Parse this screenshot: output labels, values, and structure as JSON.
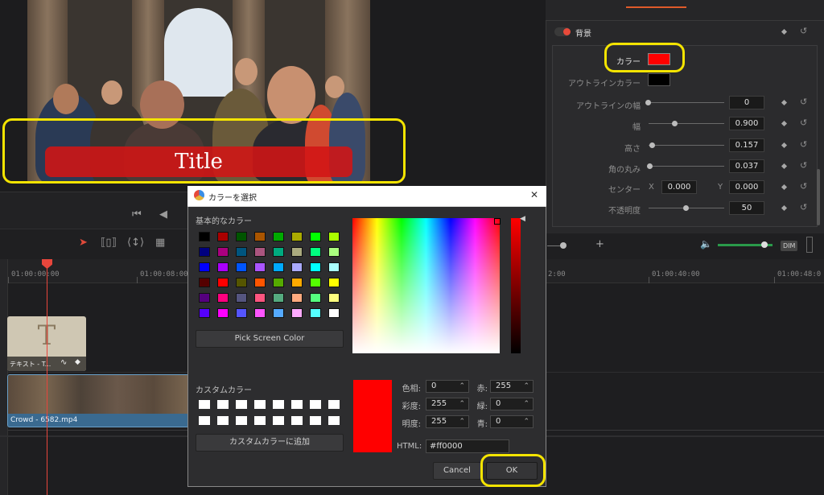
{
  "viewer": {
    "title_text": "Title"
  },
  "inspector": {
    "section_label": "背景",
    "color_label": "カラー",
    "color_value": "#ff0000",
    "outline_color_label": "アウトラインカラー",
    "rows": [
      {
        "label": "アウトラインの幅",
        "value": "0",
        "level": 0.0
      },
      {
        "label": "幅",
        "value": "0.900",
        "level": 0.35
      },
      {
        "label": "高さ",
        "value": "0.157",
        "level": 0.05
      },
      {
        "label": "角の丸み",
        "value": "0.037",
        "level": 0.02
      }
    ],
    "center_label": "センター",
    "center_x_label": "X",
    "center_x_value": "0.000",
    "center_y_label": "Y",
    "center_y_value": "0.000",
    "opacity_label": "不透明度",
    "opacity_value": "50",
    "opacity_level": 0.5
  },
  "audio": {
    "dim_label": "DIM",
    "volume_level": 0.85
  },
  "timeline": {
    "timecodes": [
      "01:00:00:00",
      "01:00:08:00",
      "2:00",
      "01:00:40:00",
      "01:00:48:0"
    ],
    "text_clip_label": "テキスト - T...",
    "video_clip_label": "Crowd - 6582.mp4"
  },
  "dialog": {
    "title": "カラーを選択",
    "close_glyph": "✕",
    "basic_colors_label": "基本的なカラー",
    "basic_colors": [
      "#000000",
      "#aa0000",
      "#005500",
      "#aa5500",
      "#00aa00",
      "#aaaa00",
      "#00ff00",
      "#aaff00",
      "#00007f",
      "#aa007f",
      "#00557f",
      "#aa557f",
      "#00aa7f",
      "#aaaa7f",
      "#00ff7f",
      "#aaff7f",
      "#0000ff",
      "#aa00ff",
      "#0055ff",
      "#aa55ff",
      "#00aaff",
      "#aaaaff",
      "#00ffff",
      "#aaffff",
      "#550000",
      "#ff0000",
      "#555500",
      "#ff5500",
      "#55aa00",
      "#ffaa00",
      "#55ff00",
      "#ffff00",
      "#55007f",
      "#ff007f",
      "#55557f",
      "#ff557f",
      "#55aa7f",
      "#ffaa7f",
      "#55ff7f",
      "#ffff7f",
      "#5500ff",
      "#ff00ff",
      "#5555ff",
      "#ff55ff",
      "#55aaff",
      "#ffaaff",
      "#55ffff",
      "#ffffff"
    ],
    "pick_screen_label": "Pick Screen Color",
    "custom_colors_label": "カスタムカラー",
    "add_custom_label": "カスタムカラーに追加",
    "hue_label": "色相:",
    "hue_value": "0",
    "sat_label": "彩度:",
    "sat_value": "255",
    "val_label": "明度:",
    "val_value": "255",
    "red_label": "赤:",
    "red_value": "255",
    "green_label": "緑:",
    "green_value": "0",
    "blue_label": "青:",
    "blue_value": "0",
    "html_label": "HTML:",
    "html_value": "#ff0000",
    "cancel_label": "Cancel",
    "ok_label": "OK",
    "current_color": "#ff0000"
  }
}
